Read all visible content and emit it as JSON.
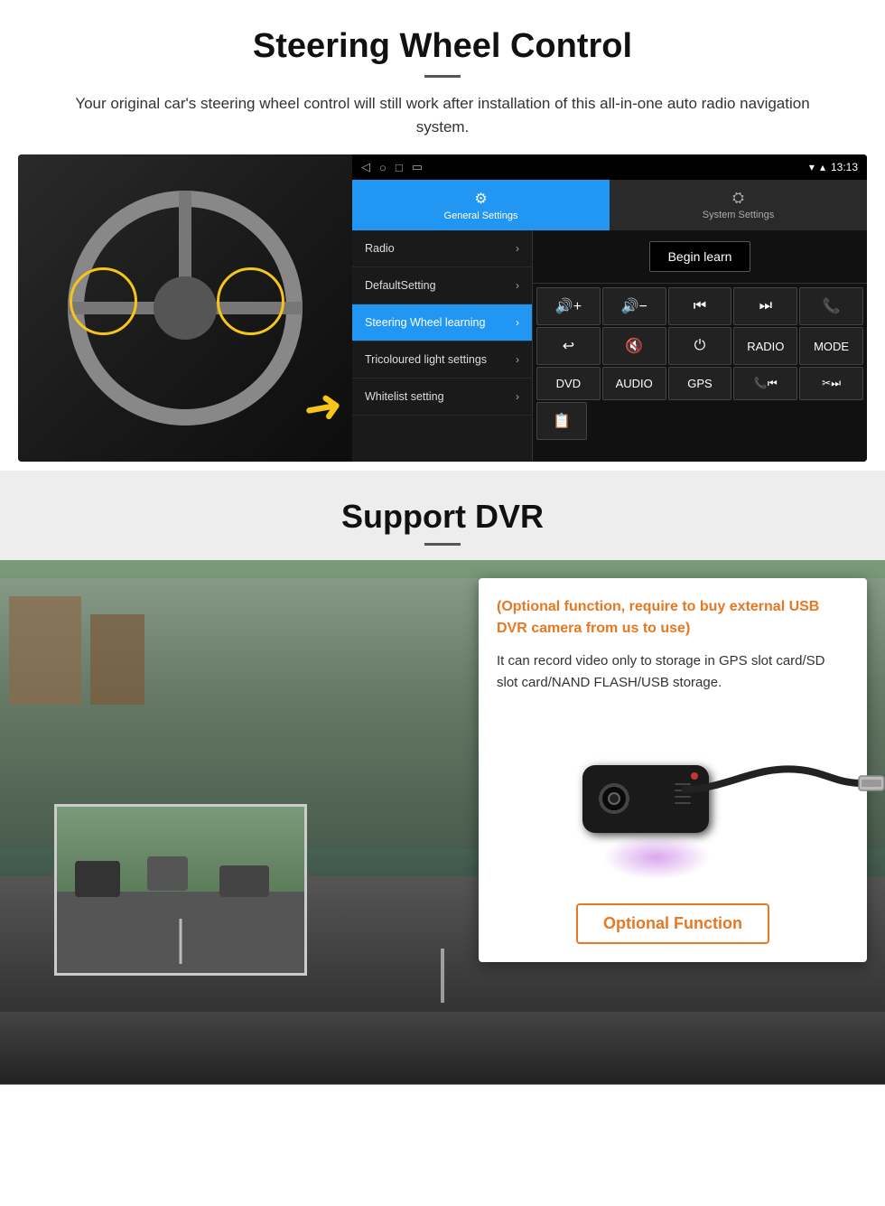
{
  "section1": {
    "title": "Steering Wheel Control",
    "description": "Your original car's steering wheel control will still work after installation of this all-in-one auto radio navigation system.",
    "android": {
      "statusbar": {
        "time": "13:13",
        "signal_icon": "▼",
        "wifi_icon": "▲"
      },
      "tabs": [
        {
          "label": "General Settings",
          "icon": "⚙",
          "active": true
        },
        {
          "label": "System Settings",
          "icon": "🌐",
          "active": false
        }
      ],
      "menu_items": [
        {
          "label": "Radio",
          "active": false
        },
        {
          "label": "DefaultSetting",
          "active": false
        },
        {
          "label": "Steering Wheel learning",
          "active": true
        },
        {
          "label": "Tricoloured light settings",
          "active": false
        },
        {
          "label": "Whitelist setting",
          "active": false
        }
      ],
      "begin_learn_label": "Begin learn",
      "control_buttons": [
        [
          "🔊+",
          "🔊−",
          "⏮",
          "⏭",
          "📞"
        ],
        [
          "↩",
          "🔇",
          "⏻",
          "RADIO",
          "MODE"
        ],
        [
          "DVD",
          "AUDIO",
          "GPS",
          "📞⏮",
          "✂⏭"
        ],
        [
          "📋"
        ]
      ]
    }
  },
  "section2": {
    "title": "Support DVR",
    "info_orange": "(Optional function, require to buy external USB DVR camera from us to use)",
    "info_text": "It can record video only to storage in GPS slot card/SD slot card/NAND FLASH/USB storage.",
    "optional_button_label": "Optional Function"
  }
}
